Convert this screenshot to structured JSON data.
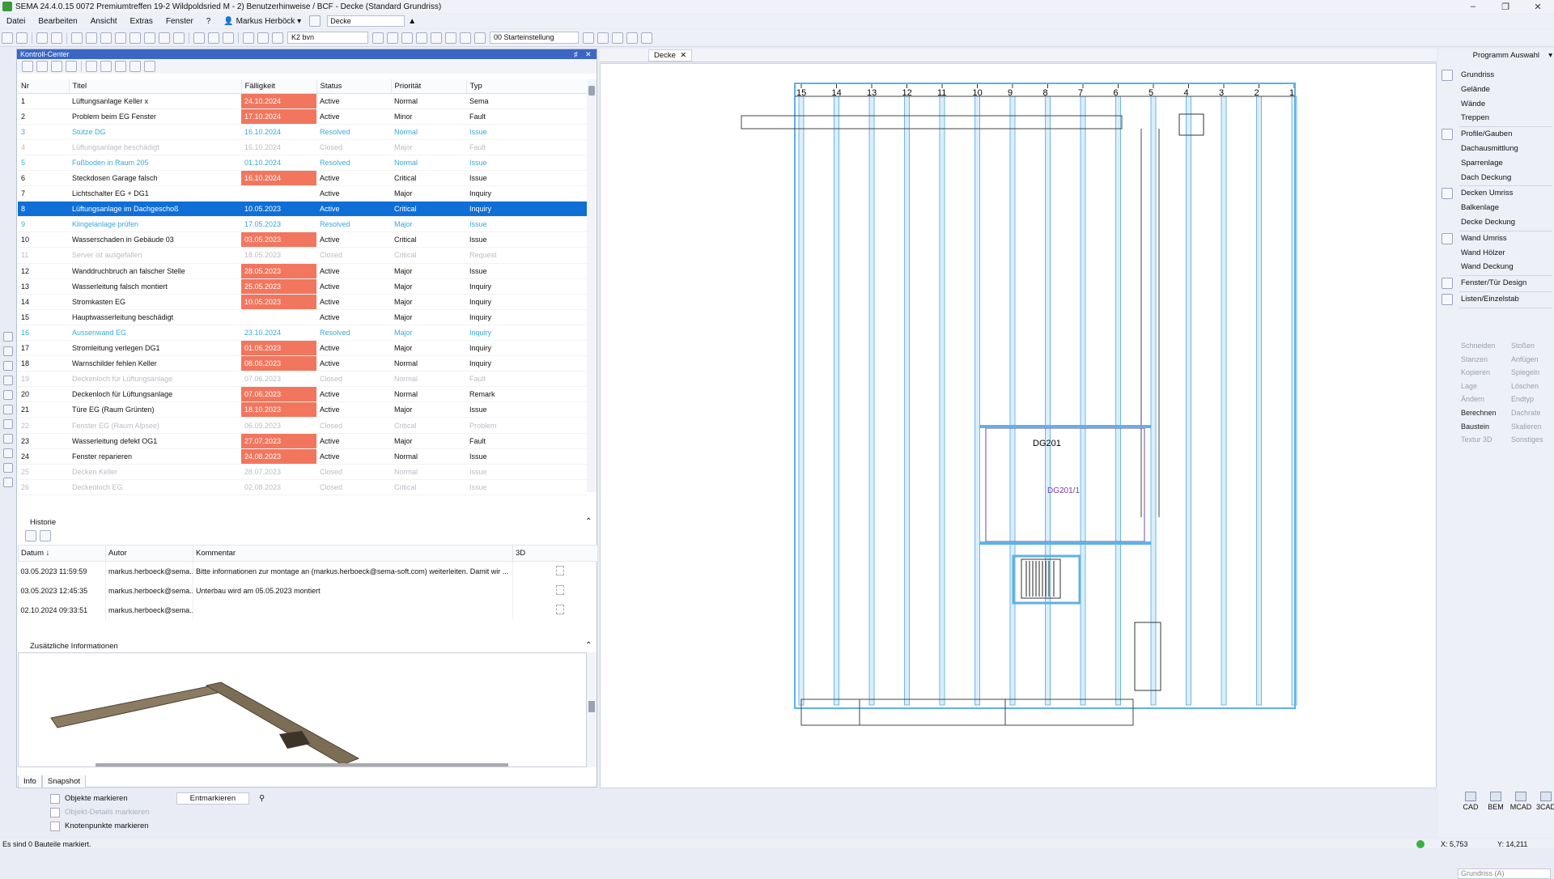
{
  "window": {
    "title": "SEMA 24.4.0.15 0072 Premiumtreffen 19-2 Wildpoldsried M - 2) Benutzerhinweise / BCF - Decke (Standard Grundriss)",
    "minimize": "–",
    "maximize": "❐",
    "close": "✕"
  },
  "menu": {
    "items": [
      "Datei",
      "Bearbeiten",
      "Ansicht",
      "Extras",
      "Fenster",
      "?"
    ],
    "user": "Markus Herböck",
    "view_combo": "Decke"
  },
  "toolbar": {
    "layer_combo": "K2 bvn",
    "start_combo": "00 Starteinstellung"
  },
  "control_center": {
    "title": "Kontroll-Center",
    "pin": "♯",
    "close": "✕",
    "columns": [
      "Nr",
      "Titel",
      "Fälligkeit",
      "Status",
      "Priorität",
      "Typ"
    ],
    "rows": [
      {
        "nr": "1",
        "titel": "Lüftungsanlage Keller x",
        "faellig": "24.10.2024",
        "status": "Active",
        "prio": "Normal",
        "typ": "Sema",
        "state": "active",
        "due_red": true
      },
      {
        "nr": "2",
        "titel": "Problem beim EG Fenster",
        "faellig": "17.10.2024",
        "status": "Active",
        "prio": "Minor",
        "typ": "Fault",
        "state": "active",
        "due_red": true
      },
      {
        "nr": "3",
        "titel": "Stütze DG",
        "faellig": "16.10.2024",
        "status": "Resolved",
        "prio": "Normal",
        "typ": "Issue",
        "state": "resolved",
        "due_red": false
      },
      {
        "nr": "4",
        "titel": "Lüftungsanlage beschädigt",
        "faellig": "16.10.2024",
        "status": "Closed",
        "prio": "Major",
        "typ": "Fault",
        "state": "closed",
        "due_red": false
      },
      {
        "nr": "5",
        "titel": "Fußboden in Raum 205",
        "faellig": "01.10.2024",
        "status": "Resolved",
        "prio": "Normal",
        "typ": "Issue",
        "state": "resolved",
        "due_red": false
      },
      {
        "nr": "6",
        "titel": "Steckdosen Garage falsch",
        "faellig": "16.10.2024",
        "status": "Active",
        "prio": "Critical",
        "typ": "Issue",
        "state": "active",
        "due_red": true
      },
      {
        "nr": "7",
        "titel": "Lichtschalter EG + DG1",
        "faellig": "",
        "status": "Active",
        "prio": "Major",
        "typ": "Inquiry",
        "state": "active",
        "due_red": false
      },
      {
        "nr": "8",
        "titel": "Lüftungsanlage im Dachgeschoß",
        "faellig": "10.05.2023",
        "status": "Active",
        "prio": "Critical",
        "typ": "Inquiry",
        "state": "selected",
        "due_red": false
      },
      {
        "nr": "9",
        "titel": "Klingelanlage prüfen",
        "faellig": "17.05.2023",
        "status": "Resolved",
        "prio": "Major",
        "typ": "Issue",
        "state": "resolved",
        "due_red": false
      },
      {
        "nr": "10",
        "titel": "Wasserschaden in Gebäude 03",
        "faellig": "03.05.2023",
        "status": "Active",
        "prio": "Critical",
        "typ": "Issue",
        "state": "active",
        "due_red": true
      },
      {
        "nr": "11",
        "titel": "Server ist ausgefallen",
        "faellig": "18.05.2023",
        "status": "Closed",
        "prio": "Critical",
        "typ": "Request",
        "state": "closed",
        "due_red": false
      },
      {
        "nr": "12",
        "titel": "Wanddruchbruch an falscher Stelle",
        "faellig": "28.05.2023",
        "status": "Active",
        "prio": "Major",
        "typ": "Issue",
        "state": "active",
        "due_red": true
      },
      {
        "nr": "13",
        "titel": "Wasserleitung falsch montiert",
        "faellig": "25.05.2023",
        "status": "Active",
        "prio": "Major",
        "typ": "Inquiry",
        "state": "active",
        "due_red": true
      },
      {
        "nr": "14",
        "titel": "Stromkasten EG",
        "faellig": "10.05.2023",
        "status": "Active",
        "prio": "Major",
        "typ": "Inquiry",
        "state": "active",
        "due_red": true
      },
      {
        "nr": "15",
        "titel": "Hauptwasserleitung beschädigt",
        "faellig": "",
        "status": "Active",
        "prio": "Major",
        "typ": "Inquiry",
        "state": "active",
        "due_red": false
      },
      {
        "nr": "16",
        "titel": "Aussenwand EG",
        "faellig": "23.10.2024",
        "status": "Resolved",
        "prio": "Major",
        "typ": "Inquiry",
        "state": "resolved",
        "due_red": false
      },
      {
        "nr": "17",
        "titel": "Stromleitung verlegen DG1",
        "faellig": "01.06.2023",
        "status": "Active",
        "prio": "Major",
        "typ": "Inquiry",
        "state": "active",
        "due_red": true
      },
      {
        "nr": "18",
        "titel": "Warnschilder fehlen Keller",
        "faellig": "08.06.2023",
        "status": "Active",
        "prio": "Normal",
        "typ": "Inquiry",
        "state": "active",
        "due_red": true
      },
      {
        "nr": "19",
        "titel": "Deckenloch für Lüftungsanlage",
        "faellig": "07.06.2023",
        "status": "Closed",
        "prio": "Normal",
        "typ": "Fault",
        "state": "closed",
        "due_red": false
      },
      {
        "nr": "20",
        "titel": "Deckenloch für Lüftungsanlage",
        "faellig": "07.06.2023",
        "status": "Active",
        "prio": "Normal",
        "typ": "Remark",
        "state": "active",
        "due_red": true
      },
      {
        "nr": "21",
        "titel": "Türe EG (Raum Grünten)",
        "faellig": "18.10.2023",
        "status": "Active",
        "prio": "Major",
        "typ": "Issue",
        "state": "active",
        "due_red": true
      },
      {
        "nr": "22",
        "titel": "Fenster EG (Raum Alpsee)",
        "faellig": "06.09.2023",
        "status": "Closed",
        "prio": "Critical",
        "typ": "Problem",
        "state": "closed",
        "due_red": false
      },
      {
        "nr": "23",
        "titel": "Wasserleitung defekt OG1",
        "faellig": "27.07.2023",
        "status": "Active",
        "prio": "Major",
        "typ": "Fault",
        "state": "active",
        "due_red": true
      },
      {
        "nr": "24",
        "titel": "Fenster reparieren",
        "faellig": "24.08.2023",
        "status": "Active",
        "prio": "Normal",
        "typ": "Issue",
        "state": "active",
        "due_red": true
      },
      {
        "nr": "25",
        "titel": "Decken Keller",
        "faellig": "28.07.2023",
        "status": "Closed",
        "prio": "Normal",
        "typ": "Issue",
        "state": "closed",
        "due_red": false
      },
      {
        "nr": "26",
        "titel": "Deckenloch EG",
        "faellig": "02.08.2023",
        "status": "Closed",
        "prio": "Critical",
        "typ": "Issue",
        "state": "closed",
        "due_red": false
      }
    ]
  },
  "history": {
    "label": "Historie",
    "columns": [
      "Datum ↓",
      "Autor",
      "Kommentar",
      "3D"
    ],
    "rows": [
      {
        "datum": "03.05.2023 11:59:59",
        "autor": "markus.herboeck@sema...",
        "kommentar": "Bitte informationen zur montage an (markus.herboeck@sema-soft.com) weiterleiten. Damit wir ..."
      },
      {
        "datum": "03.05.2023 12:45:35",
        "autor": "markus.herboeck@sema...",
        "kommentar": "Unterbau wird am 05.05.2023 montiert"
      },
      {
        "datum": "02.10.2024 09:33:51",
        "autor": "markus.herboeck@sema...",
        "kommentar": ""
      }
    ]
  },
  "extra_info": {
    "label": "Zusätzliche Informationen"
  },
  "bottom_tabs": [
    "Info",
    "Snapshot"
  ],
  "marking": {
    "objects": "Objekte markieren",
    "details": "Objekt-Details markieren",
    "nodes": "Knotenpunkte markieren",
    "unmark": "Entmarkieren"
  },
  "status": {
    "message": "Es sind 0 Bauteile markiert.",
    "x": "X: 5,753",
    "y": "Y: 14,211"
  },
  "drawing": {
    "tab": "Decke",
    "tab_close": "✕",
    "axis_labels": [
      "15",
      "14",
      "13",
      "12",
      "11",
      "10",
      "9",
      "8",
      "7",
      "6",
      "5",
      "4",
      "3",
      "2",
      "1"
    ],
    "room_label": "DG201",
    "room_sub": "DG201/1"
  },
  "right_panel": {
    "title": "Programm Auswahl",
    "groups": [
      [
        "Grundriss",
        "Gelände",
        "Wände",
        "Treppen"
      ],
      [
        "Profile/Gauben",
        "Dachausmittlung",
        "Sparrenlage",
        "Dach Deckung"
      ],
      [
        "Decken Umriss",
        "Balkenlage",
        "Decke Deckung"
      ],
      [
        "Wand Umriss",
        "Wand Hölzer",
        "Wand Deckung"
      ],
      [
        "Fenster/Tür Design"
      ],
      [
        "Listen/Einzelstab"
      ]
    ],
    "tools_left": [
      "Schneiden",
      "Stanzen",
      "Kopieren",
      "Lage",
      "Ändern",
      "Berechnen",
      "Baustein",
      "Textur 3D"
    ],
    "tools_right": [
      "Stoßen",
      "Anfügen",
      "Spiegeln",
      "Löschen",
      "Endtyp",
      "Dachrate",
      "Skalieren",
      "Sonstiges"
    ],
    "bottom_icons": [
      "CAD",
      "BEM",
      "MCAD",
      "3CAD"
    ],
    "view_combo": "Grundriss (A)"
  }
}
